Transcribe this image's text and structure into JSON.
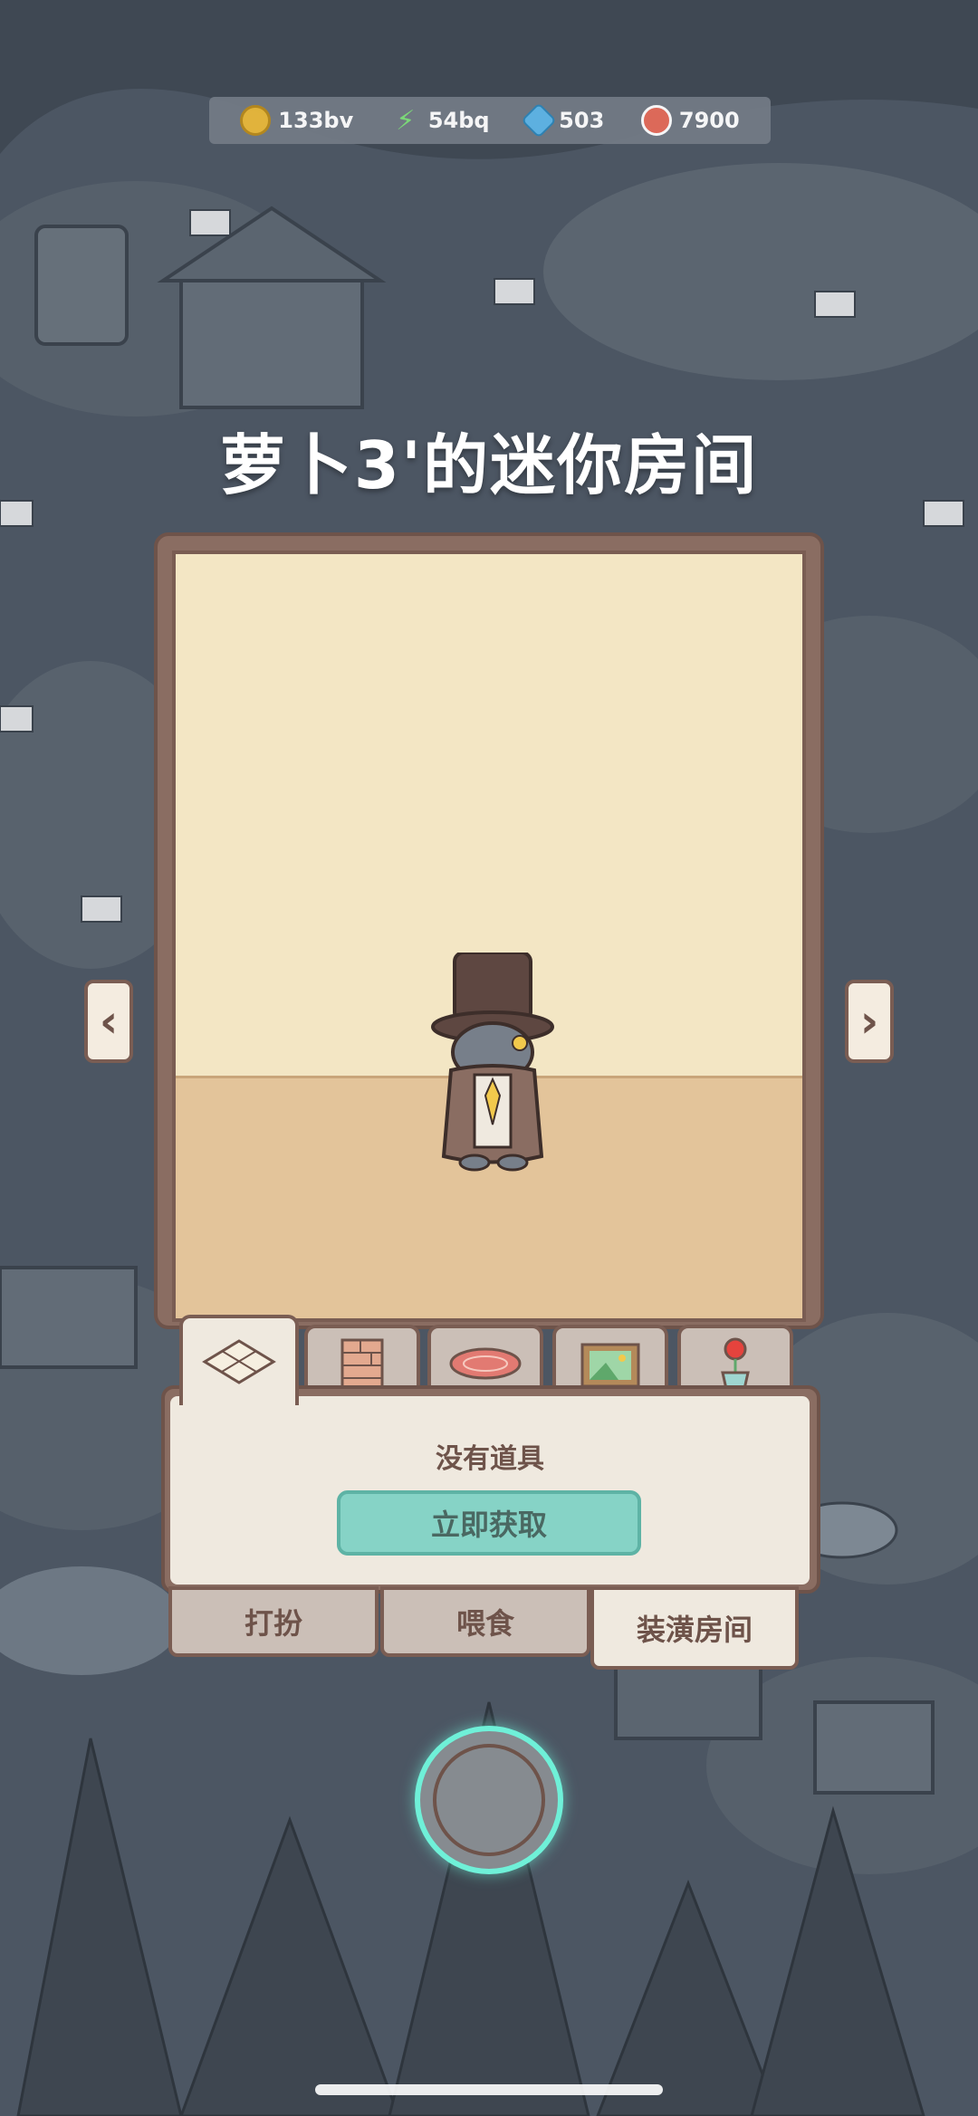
{
  "resources": [
    {
      "icon": "coin-icon",
      "value": "133bv"
    },
    {
      "icon": "energy-bolt-icon",
      "value": "54bq"
    },
    {
      "icon": "gem-icon",
      "value": "503"
    },
    {
      "icon": "food-icon",
      "value": "7900"
    }
  ],
  "room_title": "萝卜3'的迷你房间",
  "category_tabs": [
    {
      "icon": "floor-tile-icon",
      "active": true
    },
    {
      "icon": "wallpaper-icon",
      "active": false
    },
    {
      "icon": "rug-icon",
      "active": false
    },
    {
      "icon": "picture-frame-icon",
      "active": false
    },
    {
      "icon": "plant-pot-icon",
      "active": false
    }
  ],
  "panel": {
    "empty_text": "没有道具",
    "get_button": "立即获取"
  },
  "bottom_tabs": [
    {
      "label": "打扮",
      "active": false
    },
    {
      "label": "喂食",
      "active": false
    },
    {
      "label": "装潢房间",
      "active": true
    }
  ],
  "colors": {
    "accent_teal": "#86d3c6",
    "frame_brown": "#8a6d62",
    "wall": "#f3e6c4",
    "floor": "#e3c49a"
  }
}
